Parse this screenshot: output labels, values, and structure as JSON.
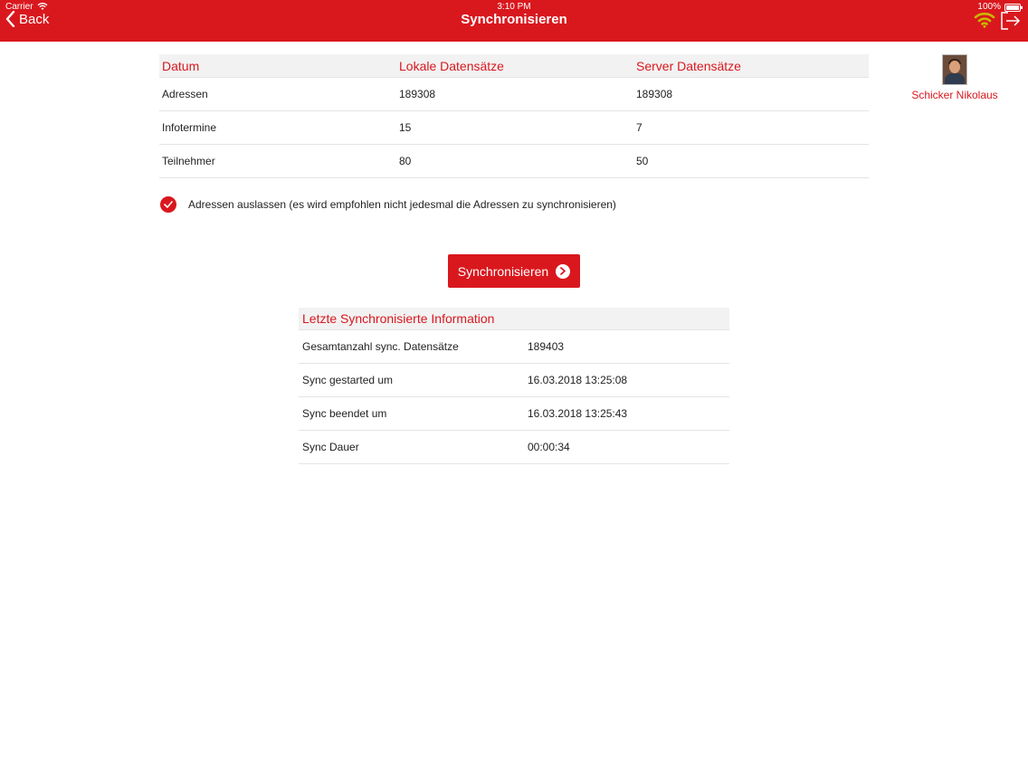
{
  "status_bar": {
    "carrier": "Carrier",
    "time": "3:10 PM",
    "battery": "100%"
  },
  "nav": {
    "back_label": "Back",
    "title": "Synchronisieren"
  },
  "user": {
    "name": "Schicker Nikolaus"
  },
  "records_table": {
    "headers": [
      "Datum",
      "Lokale Datensätze",
      "Server Datensätze"
    ],
    "rows": [
      [
        "Adressen",
        "189308",
        "189308"
      ],
      [
        "Infotermine",
        "15",
        "7"
      ],
      [
        "Teilnehmer",
        "80",
        "50"
      ]
    ]
  },
  "skip_addresses": {
    "checked": true,
    "label": "Adressen auslassen (es wird empfohlen nicht jedesmal die Adressen zu synchronisieren)"
  },
  "sync_button": {
    "label": "Synchronisieren"
  },
  "last_sync": {
    "title": "Letzte Synchronisierte Information",
    "rows": [
      [
        "Gesamtanzahl sync. Datensätze",
        "189403"
      ],
      [
        "Sync gestarted um",
        "16.03.2018 13:25:08"
      ],
      [
        "Sync beendet um",
        "16.03.2018 13:25:43"
      ],
      [
        "Sync Dauer",
        "00:00:34"
      ]
    ]
  },
  "colors": {
    "accent": "#d9181e",
    "connection_indicator": "#c9b800"
  },
  "icons": [
    "wifi-icon",
    "back-chevron-icon",
    "connection-wifi-icon",
    "logout-icon",
    "checkmark-icon",
    "arrow-right-circle-icon"
  ]
}
